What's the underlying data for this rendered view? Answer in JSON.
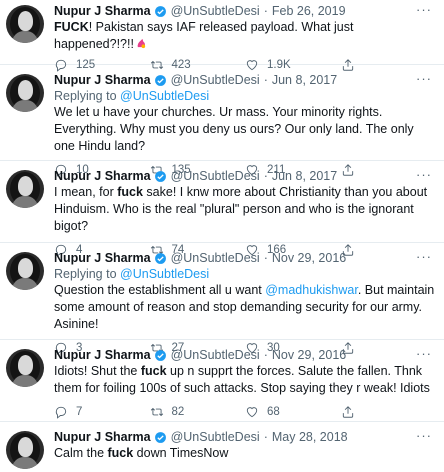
{
  "tweets": [
    {
      "name": "Nupur J Sharma",
      "handle": "@UnSubtleDesi",
      "dot": "·",
      "date": "Feb 26, 2019",
      "reply_label": "",
      "reply_handle": "",
      "text_bold": "FUCK",
      "text_rest": "! Pakistan says IAF released payload. What just happened?!?!!",
      "replies": "125",
      "retweets": "423",
      "likes": "1.9K"
    },
    {
      "name": "Nupur J Sharma",
      "handle": "@UnSubtleDesi",
      "dot": "·",
      "date": "Jun 8, 2017",
      "reply_label": "Replying to",
      "reply_handle": "@UnSubtleDesi",
      "text": "We let u have your churches. Ur mass. Your minority rights. Everything. Why must you deny us ours? Our only land. The only one Hindu land?",
      "replies": "10",
      "retweets": "135",
      "likes": "211"
    },
    {
      "name": "Nupur J Sharma",
      "handle": "@UnSubtleDesi",
      "dot": "·",
      "date": "Jun 8, 2017",
      "text_pre": "I mean, for ",
      "text_bold": "fuck",
      "text_rest": " sake! I knw more about Christianity than you about Hinduism. Who is the real \"plural\" person and who is the ignorant bigot?",
      "replies": "4",
      "retweets": "74",
      "likes": "166"
    },
    {
      "name": "Nupur J Sharma",
      "handle": "@UnSubtleDesi",
      "dot": "·",
      "date": "Nov 29, 2016",
      "reply_label": "Replying to",
      "reply_handle": "@UnSubtleDesi",
      "text_pre": "Question the establishment all u want ",
      "text_mention": "@madhukishwar",
      "text_rest": ". But maintain some amount of reason and stop demanding security for our army. Asinine!",
      "replies": "3",
      "retweets": "27",
      "likes": "30"
    },
    {
      "name": "Nupur J Sharma",
      "handle": "@UnSubtleDesi",
      "dot": "·",
      "date": "Nov 29, 2016",
      "text_pre": "Idiots! Shut the ",
      "text_bold": "fuck",
      "text_rest": " up n supprt the forces. Salute the fallen. Thnk them for foiling 100s of such attacks. Stop saying they r weak! Idiots",
      "replies": "7",
      "retweets": "82",
      "likes": "68"
    },
    {
      "name": "Nupur J Sharma",
      "handle": "@UnSubtleDesi",
      "dot": "·",
      "date": "May 28, 2018",
      "text_pre": "Calm the ",
      "text_bold": "fuck",
      "text_rest": " down TimesNow"
    }
  ],
  "more_label": "···",
  "colors": {
    "accent": "#1d9bf0",
    "muted": "#536471",
    "text": "#0f1419"
  },
  "icons": [
    "verified-badge-icon",
    "more-icon",
    "reply-icon",
    "retweet-icon",
    "like-icon",
    "share-icon",
    "emoji-icon"
  ]
}
